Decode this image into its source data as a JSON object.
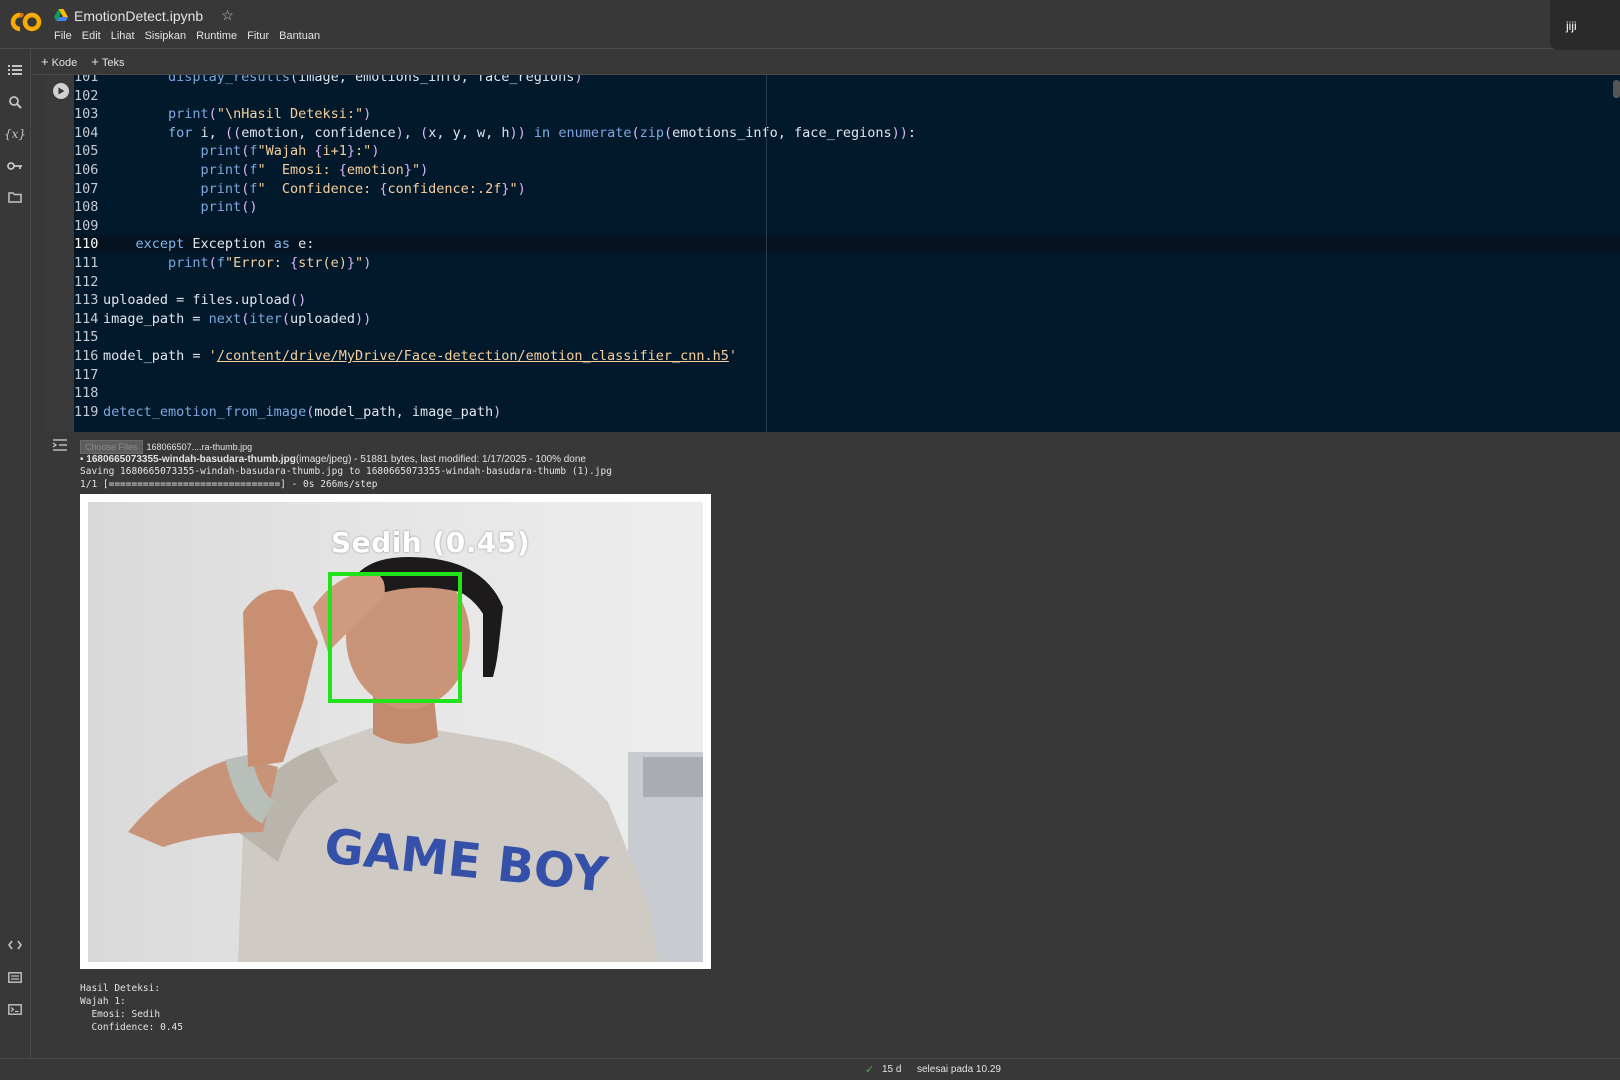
{
  "header": {
    "notebook_title": "EmotionDetect.ipynb",
    "menu": [
      "File",
      "Edit",
      "Lihat",
      "Sisipkan",
      "Runtime",
      "Fitur",
      "Bantuan"
    ],
    "user_name": "jiji"
  },
  "toolbar": {
    "code_label": "Kode",
    "text_label": "Teks"
  },
  "rail": {
    "icons": [
      "toc-icon",
      "search-icon",
      "variables-icon",
      "key-icon",
      "folder-icon",
      "code-snippets-icon",
      "command-palette-icon",
      "terminal-icon"
    ],
    "variables_glyph": "{x}"
  },
  "code": {
    "first_line": 101,
    "active_line": 110,
    "lines": [
      "        display_results(image, emotions_info, face_regions)",
      "",
      "        print(\"\\nHasil Deteksi:\")",
      "        for i, ((emotion, confidence), (x, y, w, h)) in enumerate(zip(emotions_info, face_regions)):",
      "            print(f\"Wajah {i+1}:\")",
      "            print(f\"  Emosi: {emotion}\")",
      "            print(f\"  Confidence: {confidence:.2f}\")",
      "            print()",
      "",
      "    except Exception as e:",
      "        print(f\"Error: {str(e)}\")",
      "",
      "uploaded = files.upload()",
      "image_path = next(iter(uploaded))",
      "",
      "model_path = '/content/drive/MyDrive/Face-detection/emotion_classifier_cnn.h5'",
      "",
      "",
      "detect_emotion_from_image(model_path, image_path)"
    ]
  },
  "output": {
    "choose_files_label": "Choose Files",
    "chosen_file": "168066507....ra-thumb.jpg",
    "upload_filename": "1680665073355-windah-basudara-thumb.jpg",
    "upload_details": "(image/jpeg) - 51881 bytes, last modified: 1/17/2025 - 100% done",
    "saving_line": "Saving 1680665073355-windah-basudara-thumb.jpg to 1680665073355-windah-basudara-thumb (1).jpg",
    "progress_line": "1/1 [==============================] - 0s 266ms/step",
    "detection_label": "Sedih (0.45)",
    "shirt_text": "GAME BOY",
    "result_lines": [
      "Hasil Deteksi:",
      "Wajah 1:",
      "  Emosi: Sedih",
      "  Confidence: 0.45"
    ]
  },
  "status": {
    "duration": "15 d",
    "done_text": "selesai pada 10.29"
  },
  "colors": {
    "editor_bg": "#02182b",
    "box_green": "#22e31a",
    "page_bg": "#383838"
  }
}
